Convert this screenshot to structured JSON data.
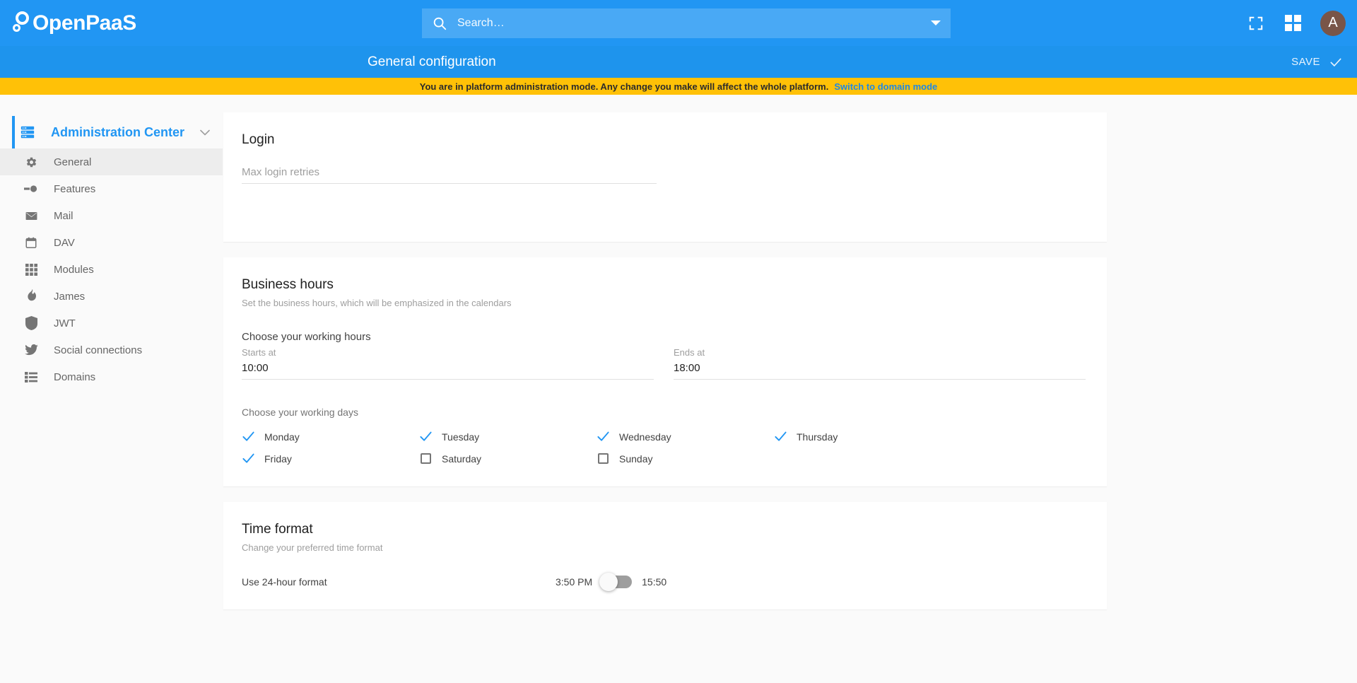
{
  "app": {
    "logo_text": "OpenPaaS",
    "accent_color": "#2196f3",
    "banner_color": "#ffc107",
    "avatar_color": "#795548"
  },
  "topbar": {
    "search_placeholder": "Search…",
    "search_value": "",
    "fullscreen_label": "fullscreen-icon",
    "apps_label": "apps-grid-icon",
    "avatar_initial": "A"
  },
  "subheader": {
    "title": "General configuration",
    "save_label": "SAVE"
  },
  "banner": {
    "message": "You are in platform administration mode. Any change you make will affect the whole platform.",
    "link_label": "Switch to domain mode"
  },
  "sidebar": {
    "header": "Administration Center",
    "items": [
      {
        "label": "General",
        "icon": "gear-icon",
        "active": true
      },
      {
        "label": "Features",
        "icon": "toggle-switch-icon",
        "active": false
      },
      {
        "label": "Mail",
        "icon": "envelope-icon",
        "active": false
      },
      {
        "label": "DAV",
        "icon": "calendar-icon",
        "active": false
      },
      {
        "label": "Modules",
        "icon": "grid-icon",
        "active": false
      },
      {
        "label": "James",
        "icon": "flame-icon",
        "active": false
      },
      {
        "label": "JWT",
        "icon": "shield-icon",
        "active": false
      },
      {
        "label": "Social connections",
        "icon": "twitter-bird-icon",
        "active": false
      },
      {
        "label": "Domains",
        "icon": "list-icon",
        "active": false
      }
    ]
  },
  "login_card": {
    "title": "Login",
    "max_retries_placeholder": "Max login retries",
    "max_retries_value": ""
  },
  "business_hours_card": {
    "title": "Business hours",
    "subtitle": "Set the business hours, which will be emphasized in the calendars",
    "hours_label": "Choose your working hours",
    "starts_label": "Starts at",
    "starts_value": "10:00",
    "ends_label": "Ends at",
    "ends_value": "18:00",
    "days_label": "Choose your working days",
    "days": [
      {
        "label": "Monday",
        "checked": true
      },
      {
        "label": "Tuesday",
        "checked": true
      },
      {
        "label": "Wednesday",
        "checked": true
      },
      {
        "label": "Thursday",
        "checked": true
      },
      {
        "label": "Friday",
        "checked": true
      },
      {
        "label": "Saturday",
        "checked": false
      },
      {
        "label": "Sunday",
        "checked": false
      }
    ]
  },
  "time_format_card": {
    "title": "Time format",
    "subtitle": "Change your preferred time format",
    "toggle_label": "Use 24-hour format",
    "ampm_example": "3:50 PM",
    "h24_example": "15:50",
    "toggle_on": false
  }
}
